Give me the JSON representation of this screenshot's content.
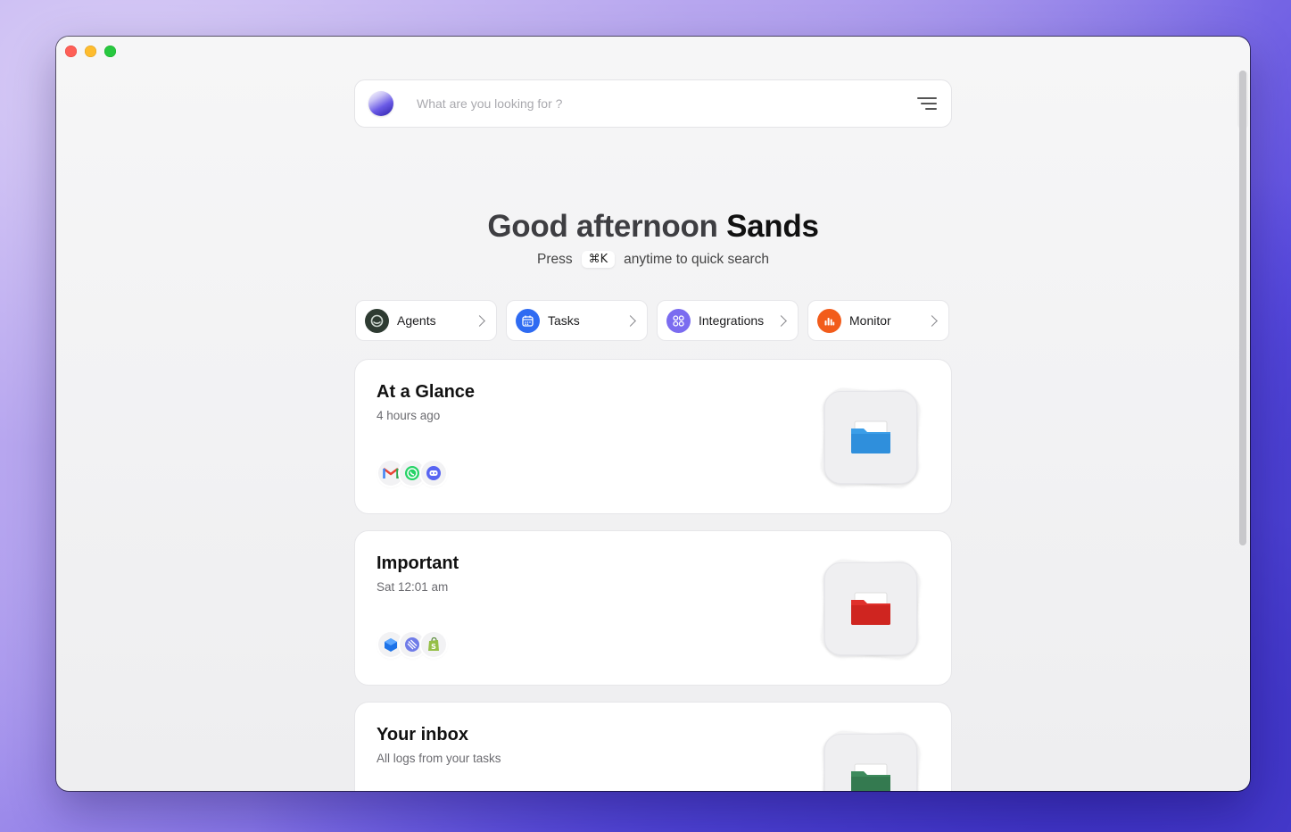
{
  "search": {
    "placeholder": "What are you looking for ?"
  },
  "greeting": {
    "prefix": "Good afternoon",
    "name": "Sands"
  },
  "hint": {
    "before": "Press",
    "shortcut": "⌘K",
    "after": "anytime to quick search"
  },
  "quick_links": [
    {
      "label": "Agents",
      "icon": "agents-icon",
      "color": "#2e3b32"
    },
    {
      "label": "Tasks",
      "icon": "calendar-icon",
      "color": "#2f6bf2"
    },
    {
      "label": "Integrations",
      "icon": "integrations-icon",
      "color": "#7b6cf0"
    },
    {
      "label": "Monitor",
      "icon": "bar-chart-icon",
      "color": "#f25c1b"
    }
  ],
  "cards": [
    {
      "title": "At a Glance",
      "subtitle": "4 hours ago",
      "apps": [
        "gmail-icon",
        "whatsapp-icon",
        "discord-icon"
      ],
      "folder_color": "#3b9ee8"
    },
    {
      "title": "Important",
      "subtitle": "Sat 12:01 am",
      "apps": [
        "box-icon",
        "linear-icon",
        "shopify-icon"
      ],
      "folder_color": "#e0302b"
    },
    {
      "title": "Your inbox",
      "subtitle": "All logs from your tasks",
      "apps": [],
      "folder_color": "#3d8a5c"
    }
  ]
}
